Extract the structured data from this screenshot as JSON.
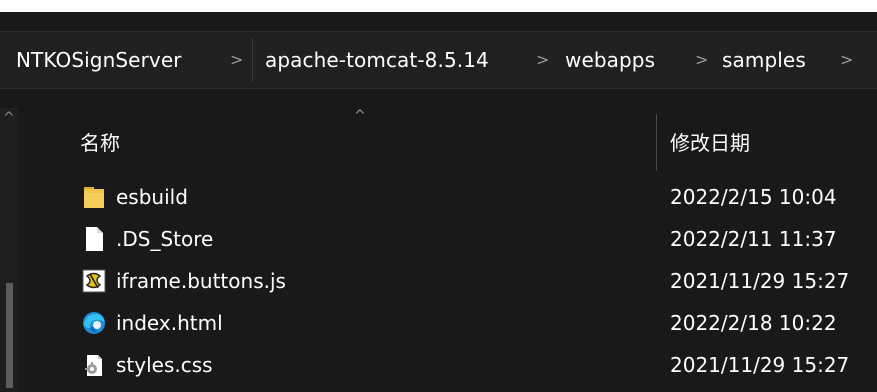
{
  "breadcrumb": [
    "NTKOSignServer",
    "apache-tomcat-8.5.14",
    "webapps",
    "samples"
  ],
  "breadcrumb_separator": ">",
  "columns": {
    "name": "名称",
    "date": "修改日期"
  },
  "files": [
    {
      "name": "esbuild",
      "date": "2022/2/15 10:04",
      "icon": "folder-icon"
    },
    {
      "name": ".DS_Store",
      "date": "2022/2/11 11:37",
      "icon": "file-icon"
    },
    {
      "name": "iframe.buttons.js",
      "date": "2021/11/29 15:27",
      "icon": "js-script-icon"
    },
    {
      "name": "index.html",
      "date": "2022/2/18 10:22",
      "icon": "edge-browser-icon"
    },
    {
      "name": "styles.css",
      "date": "2021/11/29 15:27",
      "icon": "css-file-icon"
    }
  ],
  "colors": {
    "background": "#191919",
    "address_bar": "#202020",
    "text": "#ffffff",
    "folder": "#f0c54d"
  }
}
